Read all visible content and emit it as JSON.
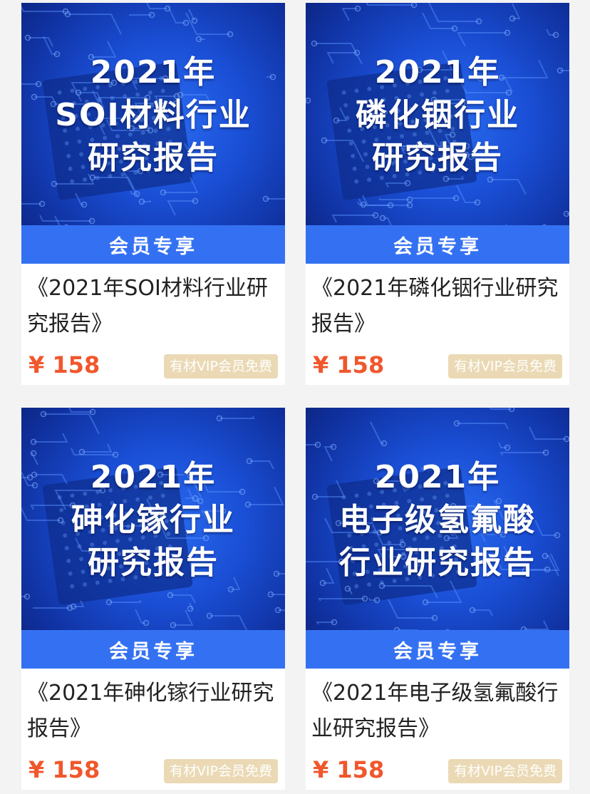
{
  "products": [
    {
      "cover_lines": [
        "2021年",
        "SOI材料行业",
        "研究报告"
      ],
      "member_label": "会员专享",
      "title": "《2021年SOI材料行业研究报告》",
      "price": "¥ 158",
      "vip_badge": "有材VIP会员免费"
    },
    {
      "cover_lines": [
        "2021年",
        "磷化铟行业",
        "研究报告"
      ],
      "member_label": "会员专享",
      "title": "《2021年磷化铟行业研究报告》",
      "price": "¥ 158",
      "vip_badge": "有材VIP会员免费"
    },
    {
      "cover_lines": [
        "2021年",
        "砷化镓行业",
        "研究报告"
      ],
      "member_label": "会员专享",
      "title": "《2021年砷化镓行业研究报告》",
      "price": "¥ 158",
      "vip_badge": "有材VIP会员免费"
    },
    {
      "cover_lines": [
        "2021年",
        "电子级氢氟酸",
        "行业研究报告"
      ],
      "member_label": "会员专享",
      "title": "《2021年电子级氢氟酸行业研究报告》",
      "price": "¥ 158",
      "vip_badge": "有材VIP会员免费"
    }
  ],
  "colors": {
    "cover_blue": "#1a4fd6",
    "band_blue": "#3471f2",
    "price_red": "#f0572c",
    "badge_gold": "#ead9b4"
  }
}
